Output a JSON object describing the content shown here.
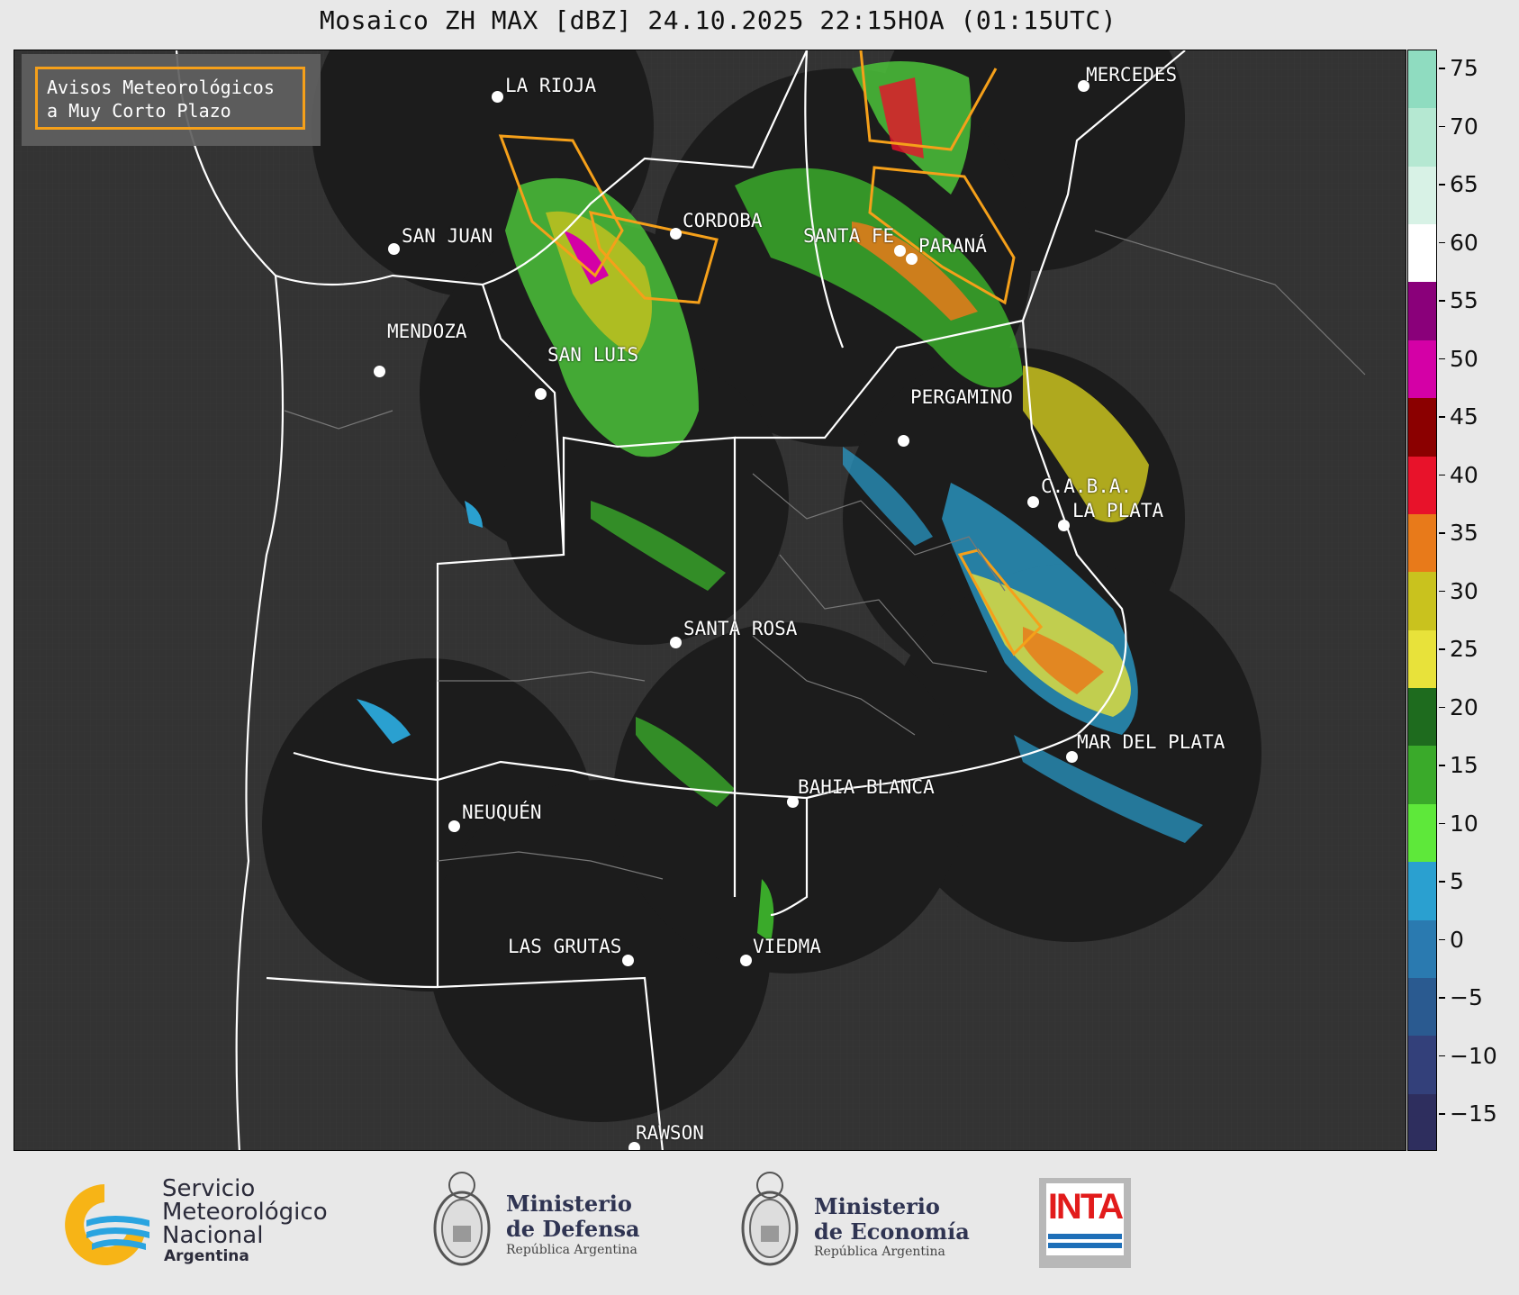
{
  "title": "Mosaico ZH MAX [dBZ] 24.10.2025 22:15HOA (01:15UTC)",
  "legend_box": {
    "line1": "Avisos Meteorológicos",
    "line2": "a Muy Corto Plazo",
    "border_color": "#f5a01a"
  },
  "cities": [
    "LA RIOJA",
    "MERCEDES",
    "SAN JUAN",
    "CORDOBA",
    "SANTA FE",
    "PARANÁ",
    "MENDOZA",
    "SAN LUIS",
    "PERGAMINO",
    "C.A.B.A.",
    "LA PLATA",
    "SANTA ROSA",
    "MAR DEL PLATA",
    "BAHIA BLANCA",
    "NEUQUÉN",
    "LAS GRUTAS",
    "VIEDMA",
    "RAWSON"
  ],
  "colorbar": {
    "unit": "dBZ",
    "ticks": [
      "75",
      "70",
      "65",
      "60",
      "55",
      "50",
      "45",
      "40",
      "35",
      "30",
      "25",
      "20",
      "15",
      "10",
      "5",
      "0",
      "−5",
      "−10",
      "−15"
    ],
    "colors": [
      "#8fdcc0",
      "#b5e8d2",
      "#d8f2e6",
      "#ffffff",
      "#8a007a",
      "#d400a6",
      "#8b0000",
      "#e8122a",
      "#e87a1a",
      "#c9c21e",
      "#e8e23a",
      "#1e6b1e",
      "#3aaa2a",
      "#5ee83a",
      "#2aa0d0",
      "#2a7ab0",
      "#2a5a90",
      "#33407a",
      "#2e2e5e"
    ]
  },
  "logos": {
    "smn_line1": "Servicio",
    "smn_line2": "Meteorológico",
    "smn_line3": "Nacional",
    "smn_line4": "Argentina",
    "defensa_line1": "Ministerio",
    "defensa_line2": "de Defensa",
    "defensa_line3": "República Argentina",
    "economia_line1": "Ministerio",
    "economia_line2": "de Economía",
    "economia_line3": "República Argentina",
    "inta": "INTA"
  }
}
